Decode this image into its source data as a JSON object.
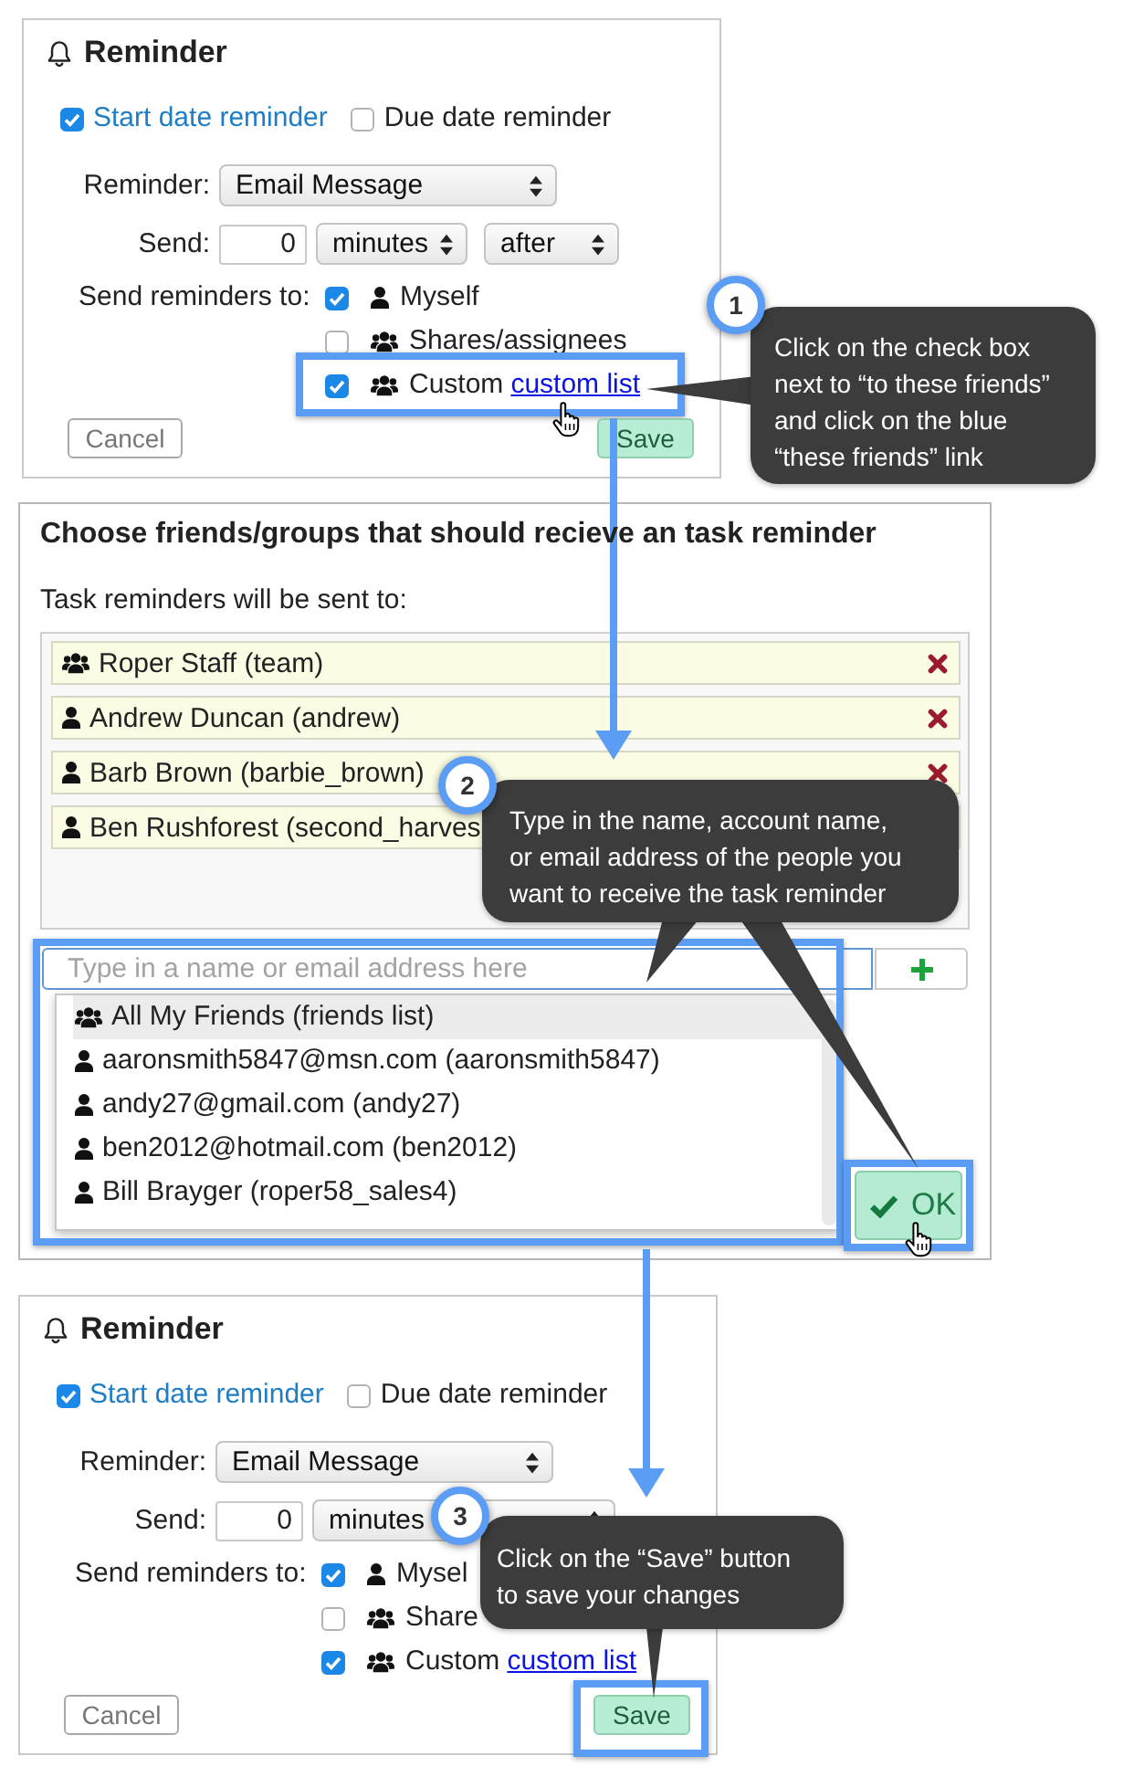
{
  "reminder_before": {
    "title": "Reminder",
    "date_options": [
      {
        "label": "Start date reminder",
        "checked": true
      },
      {
        "label": "Due date reminder",
        "checked": false
      }
    ],
    "reminder": {
      "label": "Reminder:",
      "value": "Email Message",
      "arrows": true
    },
    "send": {
      "label": "Send:",
      "amount": "0",
      "unit": {
        "value": "minutes",
        "arrows": true
      },
      "timing": {
        "value": "after",
        "arrows": true
      }
    },
    "recipients": {
      "label": "Send reminders to:",
      "options": [
        {
          "kind": "person",
          "label": "Myself",
          "checked": true,
          "highlighted": false
        },
        {
          "kind": "group",
          "label": "Shares/assignees",
          "checked": false,
          "highlighted": false
        },
        {
          "kind": "group",
          "label": "Custom",
          "link": "custom list",
          "checked": true,
          "highlighted": true
        }
      ]
    },
    "buttons": [
      {
        "kind": "cancel",
        "label": "Cancel",
        "highlighted": false
      },
      {
        "kind": "save",
        "label": "Save",
        "highlighted": false
      }
    ]
  },
  "friends_dialog": {
    "title": "Choose friends/groups that should recieve an task reminder",
    "subtitle": "Task reminders will be sent to:",
    "recipients": [
      {
        "kind": "group",
        "label": "Roper Staff (team)",
        "removable": true
      },
      {
        "kind": "person",
        "label": "Andrew Duncan (andrew)",
        "removable": true
      },
      {
        "kind": "person",
        "label": "Barb Brown (barbie_brown)",
        "removable": true
      },
      {
        "kind": "person",
        "label": "Ben Rushforest (second_harves"
      }
    ],
    "search": {
      "placeholder": "Type in a name or email address here",
      "highlighted": true,
      "suggestions": [
        {
          "kind": "group",
          "label": "All My Friends (friends list)",
          "selected": true
        },
        {
          "kind": "person",
          "label": "aaronsmith5847@msn.com (aaronsmith5847)",
          "selected": false
        },
        {
          "kind": "person",
          "label": "andy27@gmail.com (andy27)",
          "selected": false
        },
        {
          "kind": "person",
          "label": "ben2012@hotmail.com (ben2012)",
          "selected": false
        },
        {
          "kind": "person",
          "label": "Bill Brayger (roper58_sales4)",
          "selected": false
        }
      ]
    },
    "ok_button": {
      "label": "OK",
      "highlighted": true
    }
  },
  "reminder_after": {
    "title": "Reminder",
    "date_options": [
      {
        "label": "Start date reminder",
        "checked": true
      },
      {
        "label": "Due date reminder",
        "checked": false
      }
    ],
    "reminder": {
      "label": "Reminder:",
      "value": "Email Message",
      "arrows": true
    },
    "send": {
      "label": "Send:",
      "amount": "0",
      "unit": {
        "value": "minutes",
        "arrows": false
      },
      "timing": {
        "arrows": true
      }
    },
    "recipients": {
      "label": "Send reminders to:",
      "options": [
        {
          "kind": "person",
          "label": "Mysel",
          "checked": true,
          "highlighted": false
        },
        {
          "kind": "group",
          "label": "Share",
          "checked": false,
          "highlighted": false
        },
        {
          "kind": "group",
          "label": "Custom",
          "link": "custom list",
          "checked": true,
          "highlighted": false
        }
      ]
    },
    "buttons": [
      {
        "kind": "cancel",
        "label": "Cancel",
        "highlighted": false
      },
      {
        "kind": "save",
        "label": "Save",
        "highlighted": true
      }
    ]
  },
  "callouts": [
    {
      "number": "1",
      "lines": [
        "Click on the check box",
        "next to “to these friends”",
        "and click on the blue",
        "“these friends” link"
      ]
    },
    {
      "number": "2",
      "lines": [
        "Type in the name, account name,",
        "or email address of the people you",
        "want to receive the task reminder"
      ]
    },
    {
      "number": "3",
      "lines": [
        "Click on the “Save” button",
        "to save your changes"
      ]
    }
  ]
}
